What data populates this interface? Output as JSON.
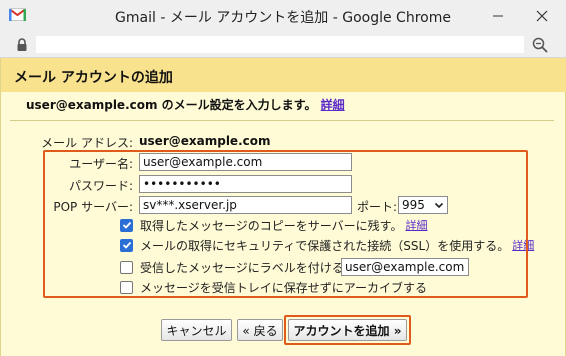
{
  "window": {
    "title": "Gmail - メール アカウントを追加 - Google Chrome"
  },
  "addressbar": {
    "url": ""
  },
  "page": {
    "title": "メール アカウントの追加",
    "instruction": "user@example.com のメール設定を入力します。",
    "instruction_link": "詳細"
  },
  "form": {
    "email_label": "メール アドレス:",
    "email_value": "user@example.com",
    "username_label": "ユーザー名:",
    "username_value": "user@example.com",
    "password_label": "パスワード:",
    "password_value": "•••••••••••",
    "pop_label": "POP サーバー:",
    "pop_value": "sv***.xserver.jp",
    "port_label": "ポート:",
    "port_value": "995"
  },
  "options": [
    {
      "label": "取得したメッセージのコピーをサーバーに残す。",
      "checked": true,
      "link": "詳細"
    },
    {
      "label": "メールの取得にセキュリティで保護された接続（SSL）を使用する。",
      "checked": true,
      "link": "詳細"
    },
    {
      "label": "受信したメッセージにラベルを付ける:",
      "checked": false,
      "select": "user@example.com"
    },
    {
      "label": "メッセージを受信トレイに保存せずにアーカイブする",
      "checked": false
    }
  ],
  "buttons": {
    "cancel": "キャンセル",
    "back": "« 戻る",
    "add": "アカウントを追加 »"
  },
  "colors": {
    "header": "#f9e28e",
    "background": "#fffbd6",
    "highlight": "#e05a1c",
    "link": "#5a2bc9",
    "checkbox": "#2b6fd6"
  }
}
